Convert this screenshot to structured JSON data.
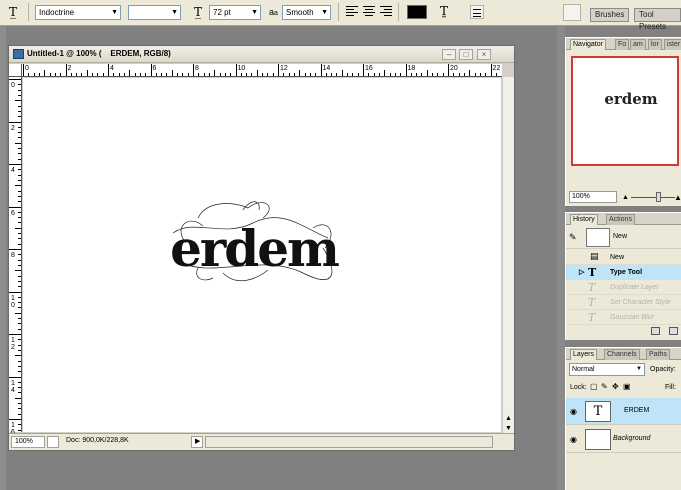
{
  "options_bar": {
    "tool_icon": "type-tool-icon",
    "font_family": "Indoctrine",
    "font_style": "",
    "size_icon": "font-size-icon",
    "font_size": "72 pt",
    "aa_icon": "anti-alias-icon",
    "aa_prefix": "a",
    "aa_sub": "a",
    "antialias": "Smooth",
    "text_color": "#000000",
    "palette_tabs": [
      "Brushes",
      "Tool Presets"
    ]
  },
  "document": {
    "title": "Untitled-1 @ 100% (    ERDEM, RGB/8)",
    "canvas_text": "erdem",
    "ruler_top": [
      "0",
      "2",
      "4",
      "6",
      "8",
      "10",
      "12",
      "14",
      "16",
      "18",
      "20",
      "22"
    ],
    "ruler_left": [
      "0",
      "2",
      "4",
      "6",
      "8",
      "1 0",
      "1 2",
      "1 4",
      "1 6",
      "1 8"
    ],
    "status_zoom": "100%",
    "status_doc": "Doc: 900,0K/228,8K"
  },
  "navigator": {
    "tabs": [
      "Navigator",
      "Fo",
      "am",
      "lor",
      "ister"
    ],
    "preview_text": "erdem",
    "zoom": "100%"
  },
  "history": {
    "tabs": [
      "History",
      "Actions"
    ],
    "snapshot_label": "New",
    "items": [
      {
        "label": "New",
        "state": "normal"
      },
      {
        "label": "Type Tool",
        "state": "selected"
      },
      {
        "label": "Duplicate Layer",
        "state": "ghost"
      },
      {
        "label": "Set Character Style",
        "state": "ghost"
      },
      {
        "label": "Gaussian Blur",
        "state": "ghost"
      }
    ]
  },
  "layers": {
    "tabs": [
      "Layers",
      "Channels",
      "Paths"
    ],
    "blend_mode": "Normal",
    "opacity_label": "Opacity:",
    "lock_label": "Lock:",
    "fill_label": "Fill:",
    "items": [
      {
        "name": "ERDEM",
        "thumb": "T",
        "selected": true
      },
      {
        "name": "Background",
        "thumb": "",
        "selected": false
      }
    ]
  }
}
